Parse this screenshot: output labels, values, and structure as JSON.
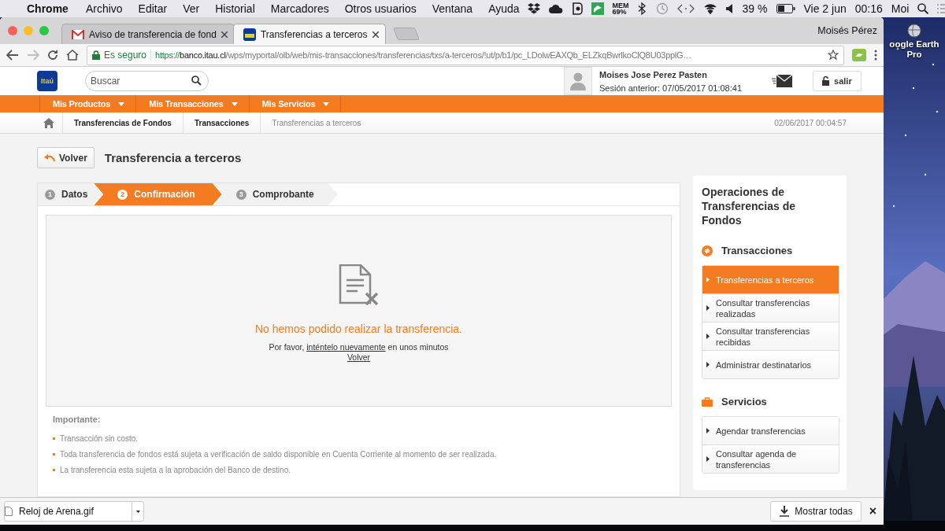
{
  "menu_bar": {
    "app": "Chrome",
    "menus": [
      "Archivo",
      "Editar",
      "Ver",
      "Historial",
      "Marcadores",
      "Otros usuarios",
      "Ventana",
      "Ayuda"
    ],
    "status": {
      "mem_label": "MEM",
      "mem_value": "69%",
      "battery": "39 %",
      "date": "Vie 2 jun",
      "time": "00:16",
      "user": "Moi"
    }
  },
  "browser": {
    "tabs": [
      {
        "title": "Aviso de transferencia de fond",
        "selected": false
      },
      {
        "title": "Transferencias a terceros",
        "selected": true
      }
    ],
    "profile": "Moisés Pérez",
    "forward_disabled": true,
    "address_bar": {
      "security": "Es seguro",
      "scheme": "https://",
      "host": "banco.itau.cl",
      "path": "/wps/myportal/olb/web/mis-transacciones/transferencias/txs/a-terceros/!ut/p/b1/pc_LDolwEAXQb_ELZkqBwrlkoClQ8U03pplG…"
    }
  },
  "page": {
    "logo": "Itaú",
    "search": {
      "placeholder": "Buscar"
    },
    "user": {
      "name": "Moises Jose Perez Pasten",
      "last_session": "Sesión anterior: 07/05/2017 01:08:41"
    },
    "logout": "salir",
    "nav": [
      "Mis Productos",
      "Mis Transacciones",
      "Mis Servicios"
    ],
    "breadcrumb": [
      {
        "label": "Transferencias de Fondos",
        "current": false
      },
      {
        "label": "Transacciones",
        "current": false
      },
      {
        "label": "Transferencias a terceros",
        "current": true
      }
    ],
    "timestamp": "02/06/2017 00:04:57",
    "back_button": "Volver",
    "title": "Transferencia a terceros",
    "steps": [
      {
        "number": "1",
        "label": "Datos",
        "selected": false
      },
      {
        "number": "2",
        "label": "Confirmación",
        "selected": true
      },
      {
        "number": "3",
        "label": "Comprobante",
        "selected": false
      }
    ],
    "error": {
      "title": "No hemos podido realizar la transferencia.",
      "before": "Por favor, ",
      "link": "inténtelo nuevamente",
      "after": " en unos minutos",
      "back_link": "Volver"
    },
    "notes": {
      "title": "Importante:",
      "items": [
        "Transacción sin costo.",
        "Toda transferencia de fondos está sujeta a verificación de saldo disponible en Cuenta Corriente al momento de ser realizada.",
        "La transferencia esta sujeta a la aprobación del Banco de destino."
      ]
    },
    "sidebar": {
      "title": "Operaciones de Transferencias de Fondos",
      "sections": [
        {
          "title": "Transacciones",
          "items": [
            {
              "label": "Transferencias a terceros",
              "selected": true
            },
            {
              "label": "Consultar transferencias realizadas",
              "selected": false
            },
            {
              "label": "Consultar transferencias recibidas",
              "selected": false
            },
            {
              "label": "Administrar destinatarios",
              "selected": false
            }
          ]
        },
        {
          "title": "Servicios",
          "items": [
            {
              "label": "Agendar transferencias",
              "selected": false
            },
            {
              "label": "Consultar agenda de transferencias",
              "selected": false
            }
          ]
        }
      ]
    }
  },
  "downloads": {
    "items": [
      {
        "file": "Reloj de Arena.gif"
      }
    ],
    "show_all": "Mostrar todas",
    "close": "×"
  },
  "desktop": {
    "icons": [
      {
        "label": "oogle Earth Pro"
      }
    ]
  }
}
